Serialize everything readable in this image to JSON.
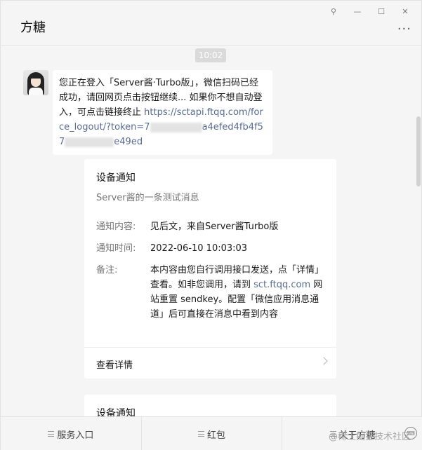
{
  "window": {
    "title": "方糖",
    "controls": {
      "pin": "⚲",
      "minimize": "—",
      "maximize": "☐",
      "close": "✕"
    },
    "more": "···"
  },
  "chat": {
    "time": "10:02",
    "message": {
      "text": "您正在登入「Server酱·Turbo版」，微信扫码已经成功，请回网页点击按钮继续... 如果你不想自动登入，可点击链接终止 ",
      "link_prefix": "https://sctapi.ftqq.com/force_logout/?token=7",
      "link_mid": "a4efed4fb4f57",
      "link_suffix": "e49ed"
    },
    "card": {
      "title": "设备通知",
      "description": "Server酱的一条测试消息",
      "rows": [
        {
          "key": "通知内容:",
          "value": "见后文，来自Server酱Turbo版"
        },
        {
          "key": "通知时间:",
          "value": "2022-06-10 10:03:03"
        },
        {
          "key": "备注:",
          "value_part1": "本内容由您自行调用接口发送，点「详情」查看。如非您调用，请到 ",
          "value_link": "sct.ftqq.com",
          "value_part2": " 网站重置 sendkey。配置「微信应用消息通道」后可直接在消息中看到内容"
        }
      ],
      "footer": "查看详情"
    },
    "card2": {
      "title": "设备通知"
    }
  },
  "bottom_menu": {
    "items": [
      "服务入口",
      "红包",
      "关于方糖"
    ],
    "watermark": "@稀土掘金技术社区"
  }
}
